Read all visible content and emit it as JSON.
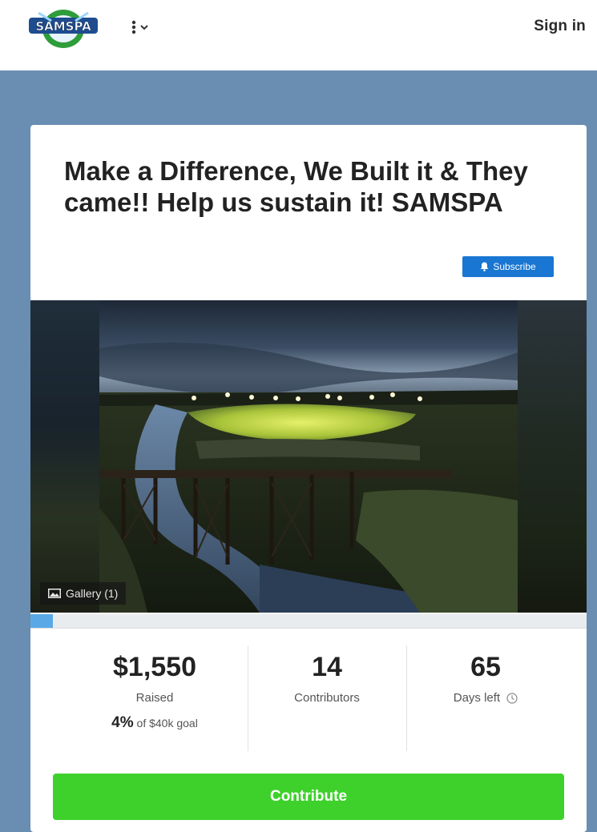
{
  "header": {
    "logo_text": "SAMSPA",
    "menu_icon": "more-vertical-icon",
    "signin_label": "Sign in"
  },
  "campaign": {
    "title": "Make a Difference, We Built it & They came!! Help us sustain it! SAMSPA",
    "subscribe_label": "Subscribe",
    "gallery_label": "Gallery (1)",
    "progress_fraction": 0.04
  },
  "stats": {
    "raised_value": "$1,550",
    "raised_label": "Raised",
    "goal_percent": "4%",
    "goal_text": "of $40k goal",
    "contributors_value": "14",
    "contributors_label": "Contributors",
    "days_value": "65",
    "days_label": "Days left"
  },
  "actions": {
    "contribute_label": "Contribute"
  },
  "colors": {
    "band": "#6a8db2",
    "subscribe": "#1976d2",
    "contribute": "#3ed12b",
    "progress": "#5aa9e6"
  }
}
